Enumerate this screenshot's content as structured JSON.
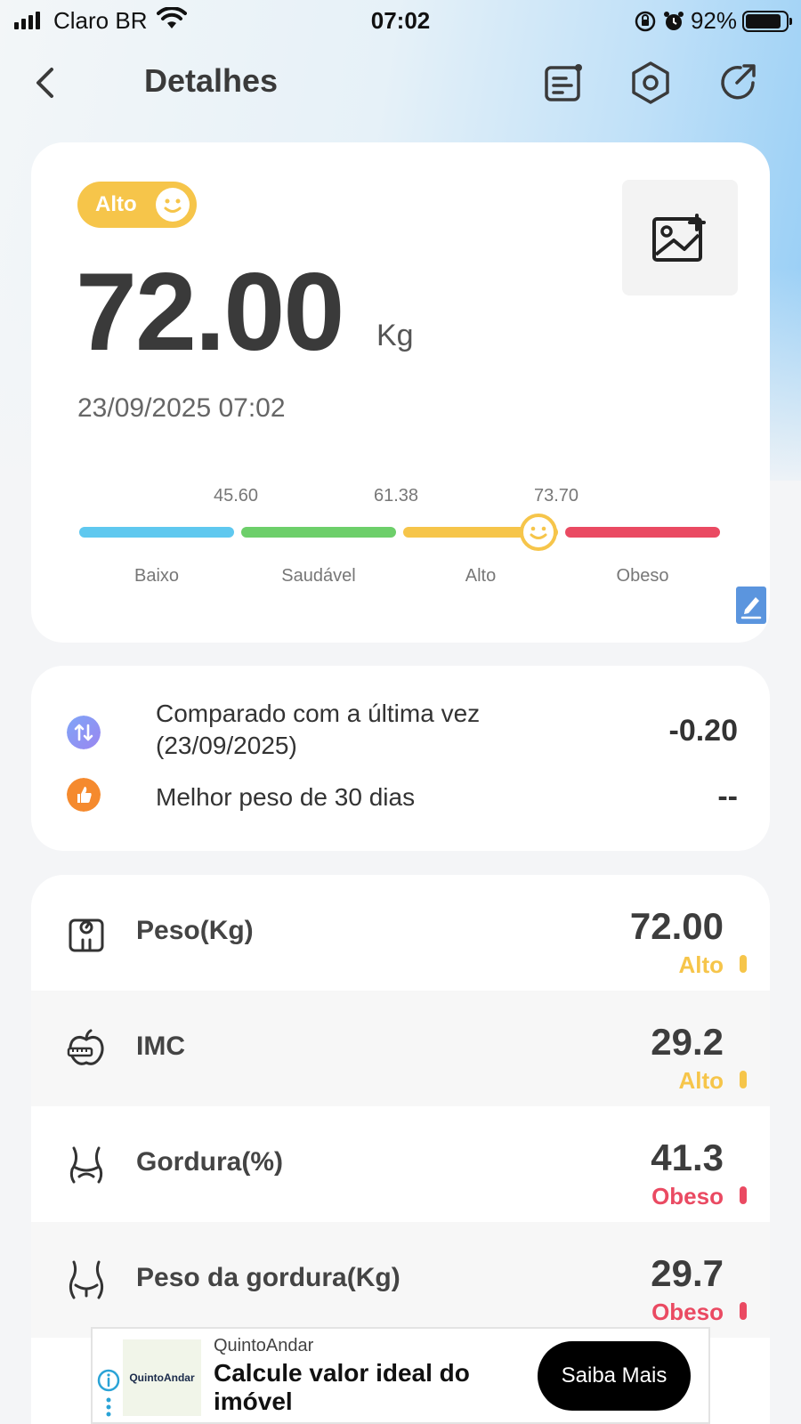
{
  "status_bar": {
    "carrier": "Claro BR",
    "time": "07:02",
    "battery": "92%",
    "battery_level": 0.92
  },
  "header": {
    "title": "Detalhes",
    "icons": [
      "back-icon",
      "report-icon",
      "hexagon-settings-icon",
      "share-icon"
    ]
  },
  "weight_card": {
    "badge": "Alto",
    "value": "72.00",
    "unit": "Kg",
    "datetime": "23/09/2025 07:02",
    "thresholds": [
      "45.60",
      "61.38",
      "73.70"
    ],
    "segments": [
      {
        "label": "Baixo",
        "color": "#5fc8ef"
      },
      {
        "label": "Saudável",
        "color": "#6dcf6a"
      },
      {
        "label": "Alto",
        "color": "#f6c54a"
      },
      {
        "label": "Obeso",
        "color": "#ea4a62"
      }
    ],
    "marker_value": 72.0
  },
  "comparison": {
    "row1_text": "Comparado com a última vez (23/09/2025)",
    "row1_value": "-0.20",
    "row2_text": "Melhor peso de 30 dias",
    "row2_value": "--"
  },
  "metrics": [
    {
      "name": "Peso(Kg)",
      "value": "72.00",
      "status": "Alto",
      "status_color": "#f6c54a",
      "icon": "scale-icon"
    },
    {
      "name": "IMC",
      "value": "29.2",
      "status": "Alto",
      "status_color": "#f6c54a",
      "icon": "apple-tape-icon"
    },
    {
      "name": "Gordura(%)",
      "value": "41.3",
      "status": "Obeso",
      "status_color": "#ea4a62",
      "icon": "waist-icon"
    },
    {
      "name": "Peso da gordura(Kg)",
      "value": "29.7",
      "status": "Obeso",
      "status_color": "#ea4a62",
      "icon": "belly-icon"
    }
  ],
  "ad": {
    "logo_text": "QuintoAndar",
    "brand": "QuintoAndar",
    "headline": "Calcule valor ideal do imóvel",
    "cta": "Saiba Mais"
  }
}
